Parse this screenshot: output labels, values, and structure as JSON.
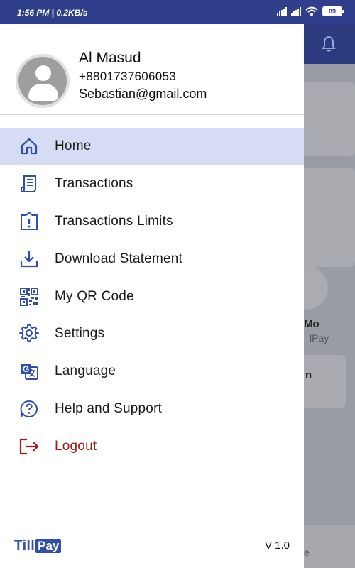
{
  "status_bar": {
    "time": "1:56 PM | 0.2KB/s",
    "battery": "89"
  },
  "background": {
    "partial_name": "Mo",
    "partial_sub": "lPay",
    "partial_btn": "n",
    "partial_bottom": "e"
  },
  "profile": {
    "name": "Al Masud",
    "phone": "+8801737606053",
    "email": "Sebastian@gmail.com"
  },
  "menu": {
    "items": [
      {
        "label": "Home",
        "icon": "home-icon",
        "active": true
      },
      {
        "label": "Transactions",
        "icon": "receipt-icon"
      },
      {
        "label": "Transactions Limits",
        "icon": "limit-alert-icon"
      },
      {
        "label": "Download Statement",
        "icon": "download-icon"
      },
      {
        "label": "My QR Code",
        "icon": "qr-code-icon"
      },
      {
        "label": "Settings",
        "icon": "gear-icon"
      },
      {
        "label": "Language",
        "icon": "translate-icon"
      },
      {
        "label": "Help and Support",
        "icon": "help-icon"
      },
      {
        "label": "Logout",
        "icon": "logout-icon"
      }
    ]
  },
  "brand": {
    "till": "Till",
    "pay": "Pay"
  },
  "version": "V 1.0",
  "colors": {
    "primary": "#2f4fa8",
    "active_bg": "#d6dcf3",
    "logout": "#a11a1a"
  }
}
